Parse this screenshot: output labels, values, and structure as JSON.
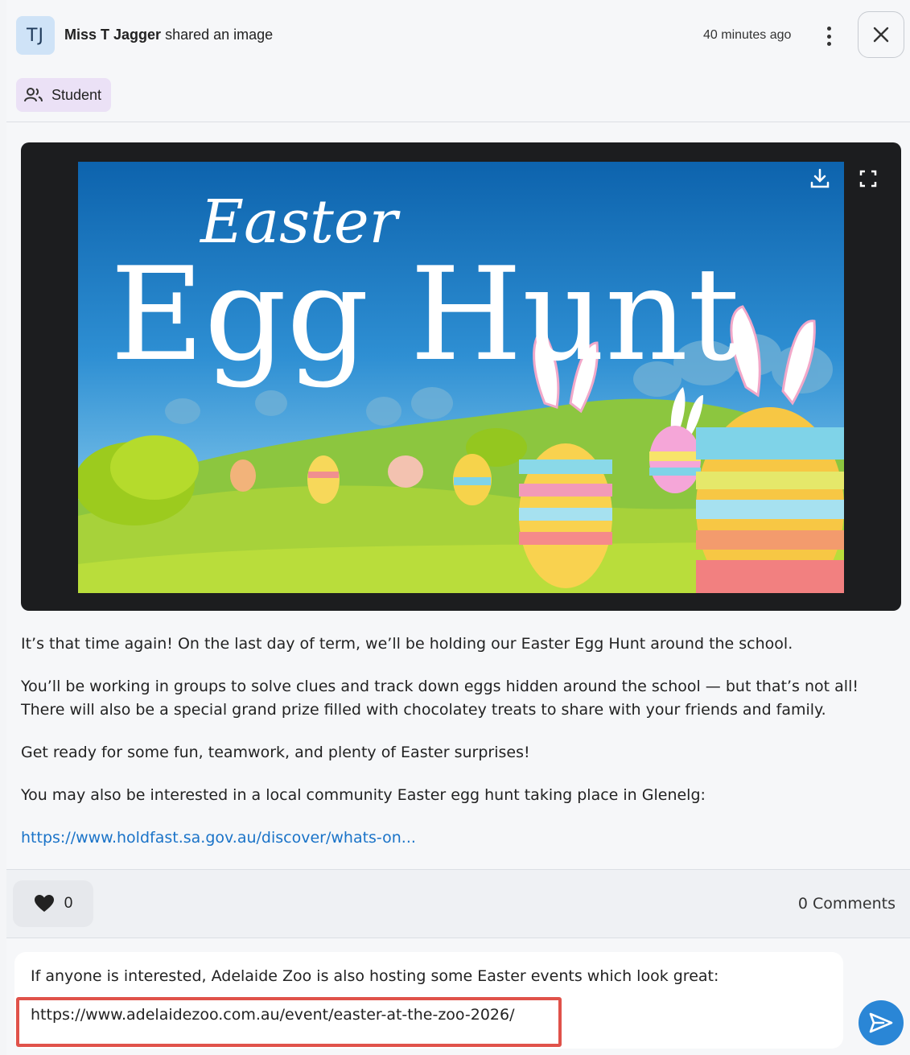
{
  "post": {
    "avatar_initials": "TJ",
    "author": "Miss T Jagger",
    "action": "shared an image",
    "timestamp": "40 minutes ago",
    "audience_badge": "Student",
    "image_title_script": "Easter",
    "image_title_main": "Egg Hunt",
    "paragraphs": [
      "It’s that time again! On the last day of term, we’ll be holding our Easter Egg Hunt around the school.",
      "You’ll be working in groups to solve clues and track down eggs hidden around the school — but that’s not all! There will also be a special grand prize filled with chocolatey treats to share with your friends and family.",
      "Get ready for some fun, teamwork, and plenty of Easter surprises!",
      "You may also be interested in a local community Easter egg hunt taking place in Glenelg:"
    ],
    "link_text": "https://www.holdfast.sa.gov.au/discover/whats-on..."
  },
  "reactions": {
    "like_count": "0",
    "comments_label": "0 Comments"
  },
  "composer": {
    "line1": "If anyone is interested, Adelaide Zoo is also hosting some Easter events which look great:",
    "line2": "https://www.adelaidezoo.com.au/event/easter-at-the-zoo-2026/"
  },
  "colors": {
    "accent_blue": "#2a86d6",
    "link_blue": "#1a73c8",
    "highlight_red": "#e0524a",
    "badge_purple": "#ebe1f6"
  },
  "icons": {
    "audience": "people-icon",
    "download": "download-icon",
    "expand": "fullscreen-icon",
    "like": "heart-icon",
    "send": "send-icon",
    "close": "close-icon",
    "menu": "kebab-menu-icon"
  }
}
